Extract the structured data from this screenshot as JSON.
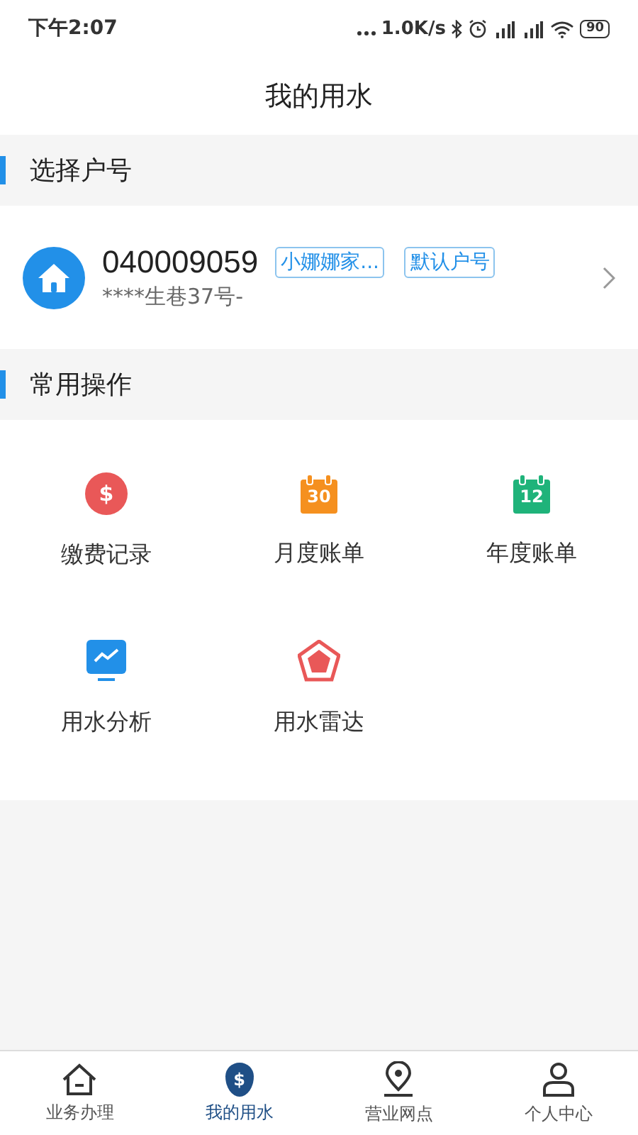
{
  "status_bar": {
    "time": "下午2:07",
    "speed": "1.0K/s",
    "battery": "90"
  },
  "header": {
    "title": "我的用水"
  },
  "account_section": {
    "title": "选择户号"
  },
  "account": {
    "number": "040009059",
    "tags": [
      "小娜娜家...",
      "默认户号"
    ],
    "address": "****生巷37号-"
  },
  "actions_section": {
    "title": "常用操作"
  },
  "actions": [
    {
      "label": "缴费记录",
      "kind": "coin",
      "icon_text": "$",
      "color": "#e95858"
    },
    {
      "label": "月度账单",
      "kind": "calendar",
      "icon_text": "30",
      "color": "#f5901f"
    },
    {
      "label": "年度账单",
      "kind": "calendar",
      "icon_text": "12",
      "color": "#1fb37a"
    },
    {
      "label": "用水分析",
      "kind": "chart",
      "color": "#2290e8"
    },
    {
      "label": "用水雷达",
      "kind": "radar",
      "color": "#e95858"
    }
  ],
  "tab_bar": [
    {
      "label": "业务办理",
      "kind": "home",
      "selected": false
    },
    {
      "label": "我的用水",
      "kind": "drop",
      "icon_text": "$",
      "selected": true
    },
    {
      "label": "营业网点",
      "kind": "pin",
      "selected": false
    },
    {
      "label": "个人中心",
      "kind": "person",
      "selected": false
    }
  ]
}
